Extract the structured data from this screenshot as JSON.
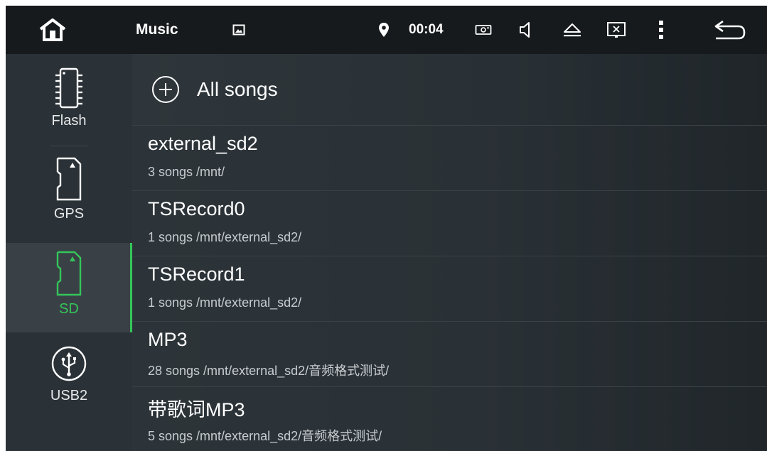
{
  "statusbar": {
    "app_title": "Music",
    "clock": "00:04",
    "icons": [
      "home-icon",
      "image-icon",
      "location-pin-icon",
      "screen-capture-icon",
      "volume-icon",
      "eject-icon",
      "close-screen-icon",
      "more-options-icon",
      "back-icon"
    ]
  },
  "sidebar": {
    "accent_color": "#34c65a",
    "items": [
      {
        "label": "Flash",
        "icon": "flash-chip-icon",
        "active": false
      },
      {
        "label": "GPS",
        "icon": "sd-card-icon",
        "active": false
      },
      {
        "label": "SD",
        "icon": "sd-card-icon",
        "active": true
      },
      {
        "label": "USB2",
        "icon": "usb-icon",
        "active": false
      }
    ]
  },
  "list": {
    "all_songs_label": "All songs",
    "folders": [
      {
        "title": "external_sd2",
        "sub": "3 songs /mnt/"
      },
      {
        "title": "TSRecord0",
        "sub": "1 songs /mnt/external_sd2/"
      },
      {
        "title": "TSRecord1",
        "sub": "1 songs /mnt/external_sd2/"
      },
      {
        "title": "MP3",
        "sub": "28 songs /mnt/external_sd2/音频格式测试/"
      },
      {
        "title": "带歌词MP3",
        "sub": "5 songs /mnt/external_sd2/音频格式测试/"
      }
    ]
  }
}
